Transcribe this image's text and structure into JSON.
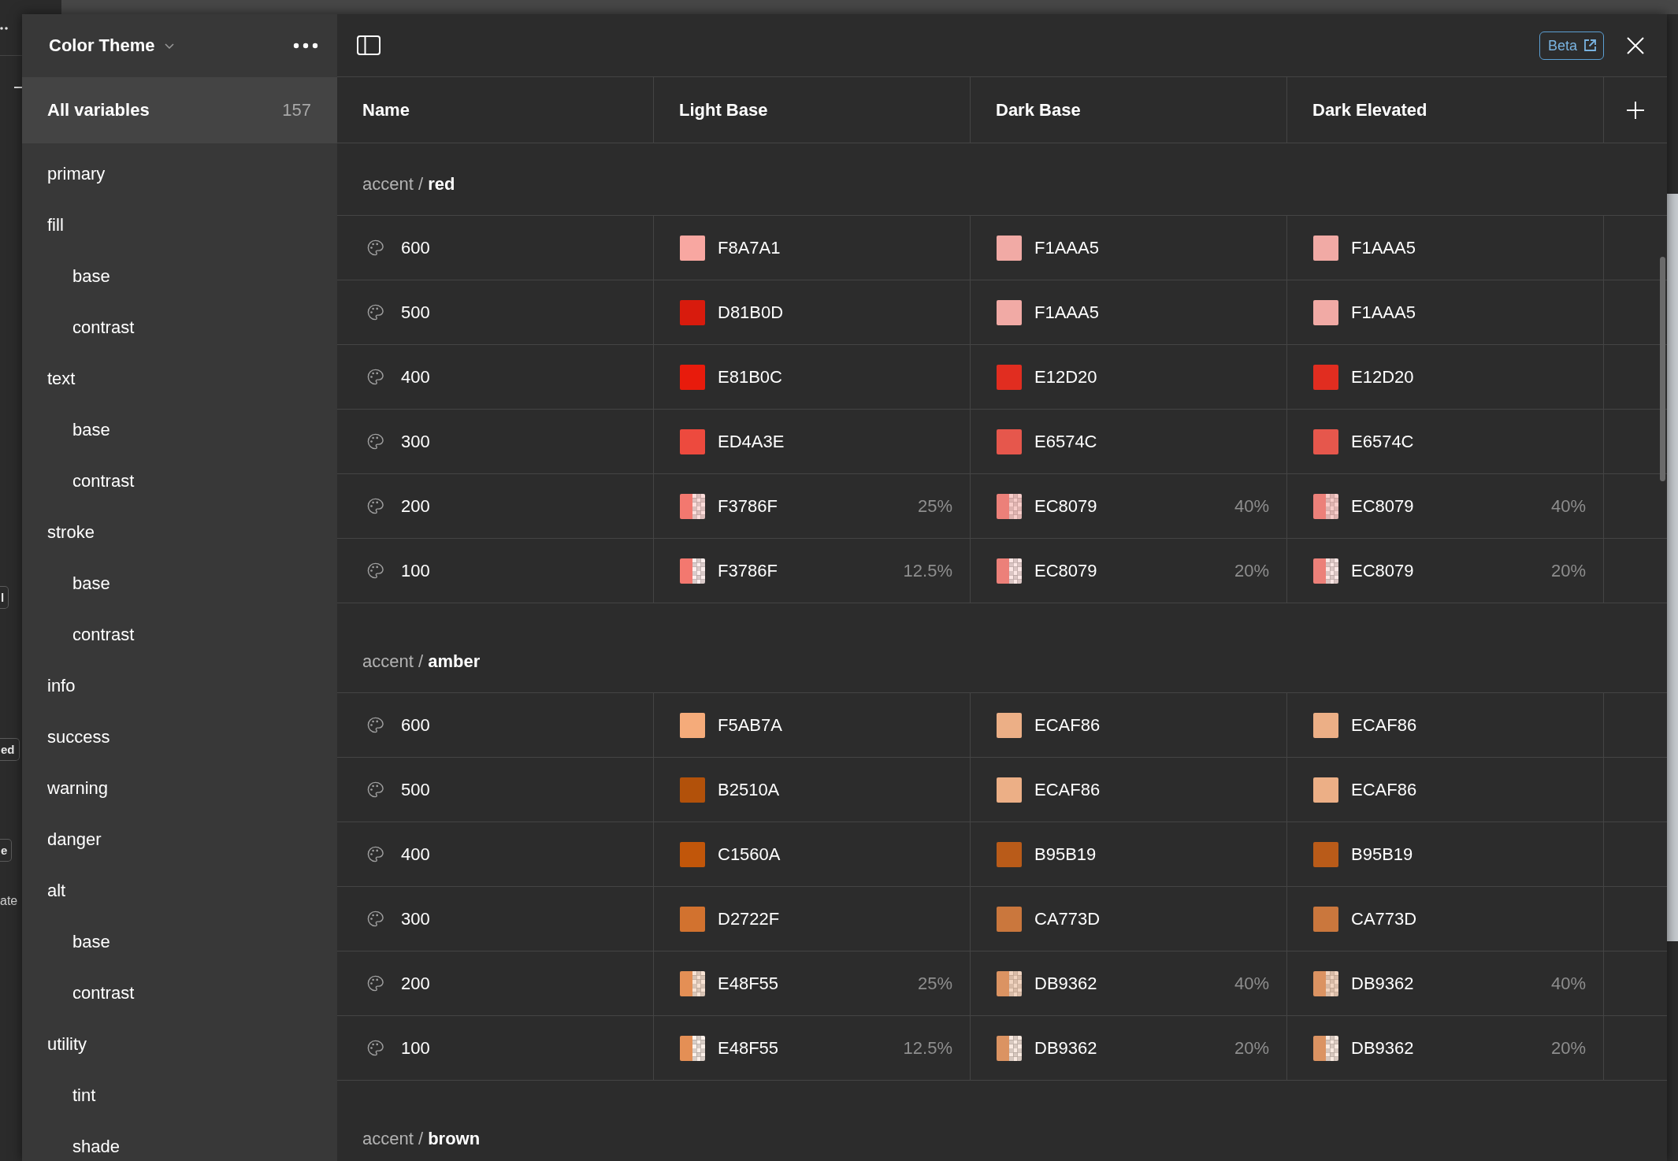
{
  "background": {
    "chips": [
      "l",
      "ed",
      "e"
    ],
    "caption": "ate"
  },
  "sidebar": {
    "title": "Color Theme",
    "items": [
      {
        "kind": "summary",
        "label": "All variables",
        "count": "157",
        "selected": true
      },
      {
        "kind": "group",
        "label": "primary",
        "selected": false
      },
      {
        "kind": "group",
        "label": "fill",
        "selected": false,
        "children": [
          {
            "kind": "group",
            "label": "base",
            "selected": false
          },
          {
            "kind": "group",
            "label": "contrast",
            "selected": false
          }
        ]
      },
      {
        "kind": "group",
        "label": "text",
        "selected": false,
        "children": [
          {
            "kind": "group",
            "label": "base",
            "selected": false
          },
          {
            "kind": "group",
            "label": "contrast",
            "selected": false
          }
        ]
      },
      {
        "kind": "group",
        "label": "stroke",
        "selected": false,
        "children": [
          {
            "kind": "group",
            "label": "base",
            "selected": false
          },
          {
            "kind": "group",
            "label": "contrast",
            "selected": false
          }
        ]
      },
      {
        "kind": "group",
        "label": "info",
        "selected": false
      },
      {
        "kind": "group",
        "label": "success",
        "selected": false
      },
      {
        "kind": "group",
        "label": "warning",
        "selected": false
      },
      {
        "kind": "group",
        "label": "danger",
        "selected": false
      },
      {
        "kind": "group",
        "label": "alt",
        "selected": false,
        "children": [
          {
            "kind": "group",
            "label": "base",
            "selected": false
          },
          {
            "kind": "group",
            "label": "contrast",
            "selected": false
          }
        ]
      },
      {
        "kind": "group",
        "label": "utility",
        "selected": false,
        "children": [
          {
            "kind": "group",
            "label": "tint",
            "selected": false
          },
          {
            "kind": "group",
            "label": "shade",
            "selected": false
          }
        ]
      }
    ]
  },
  "toolbar": {
    "badge": "Beta"
  },
  "table": {
    "columns": [
      "Name",
      "Light Base",
      "Dark Base",
      "Dark Elevated"
    ],
    "groups": [
      {
        "title": "accent / **red**",
        "rows": [
          {
            "name": "600",
            "cells": [
              {
                "hex": "F8A7A1",
                "color": "#f8a7a1"
              },
              {
                "hex": "F1AAA5",
                "color": "#f1aaa5"
              },
              {
                "hex": "F1AAA5",
                "color": "#f1aaa5"
              }
            ]
          },
          {
            "name": "500",
            "cells": [
              {
                "hex": "D81B0D",
                "color": "#d81b0d"
              },
              {
                "hex": "F1AAA5",
                "color": "#f1aaa5"
              },
              {
                "hex": "F1AAA5",
                "color": "#f1aaa5"
              }
            ]
          },
          {
            "name": "400",
            "cells": [
              {
                "hex": "E81B0C",
                "color": "#e81b0c"
              },
              {
                "hex": "E12D20",
                "color": "#e12d20"
              },
              {
                "hex": "E12D20",
                "color": "#e12d20"
              }
            ]
          },
          {
            "name": "300",
            "cells": [
              {
                "hex": "ED4A3E",
                "color": "#ed4a3e"
              },
              {
                "hex": "E6574C",
                "color": "#e6574c"
              },
              {
                "hex": "E6574C",
                "color": "#e6574c"
              }
            ]
          },
          {
            "name": "200",
            "cells": [
              {
                "hex": "F3786F",
                "color": "#f3786f",
                "alpha": "25%"
              },
              {
                "hex": "EC8079",
                "color": "#ec8079",
                "alpha": "40%"
              },
              {
                "hex": "EC8079",
                "color": "#ec8079",
                "alpha": "40%"
              }
            ]
          },
          {
            "name": "100",
            "cells": [
              {
                "hex": "F3786F",
                "color": "#f3786f",
                "alpha": "12.5%"
              },
              {
                "hex": "EC8079",
                "color": "#ec8079",
                "alpha": "20%"
              },
              {
                "hex": "EC8079",
                "color": "#ec8079",
                "alpha": "20%"
              }
            ]
          }
        ]
      },
      {
        "title": "accent / **amber**",
        "rows": [
          {
            "name": "600",
            "cells": [
              {
                "hex": "F5AB7A",
                "color": "#f5ab7a"
              },
              {
                "hex": "ECAF86",
                "color": "#ecaf86"
              },
              {
                "hex": "ECAF86",
                "color": "#ecaf86"
              }
            ]
          },
          {
            "name": "500",
            "cells": [
              {
                "hex": "B2510A",
                "color": "#b2510a"
              },
              {
                "hex": "ECAF86",
                "color": "#ecaf86"
              },
              {
                "hex": "ECAF86",
                "color": "#ecaf86"
              }
            ]
          },
          {
            "name": "400",
            "cells": [
              {
                "hex": "C1560A",
                "color": "#c1560a"
              },
              {
                "hex": "B95B19",
                "color": "#b95b19"
              },
              {
                "hex": "B95B19",
                "color": "#b95b19"
              }
            ]
          },
          {
            "name": "300",
            "cells": [
              {
                "hex": "D2722F",
                "color": "#d2722f"
              },
              {
                "hex": "CA773D",
                "color": "#ca773d"
              },
              {
                "hex": "CA773D",
                "color": "#ca773d"
              }
            ]
          },
          {
            "name": "200",
            "cells": [
              {
                "hex": "E48F55",
                "color": "#e48f55",
                "alpha": "25%"
              },
              {
                "hex": "DB9362",
                "color": "#db9362",
                "alpha": "40%"
              },
              {
                "hex": "DB9362",
                "color": "#db9362",
                "alpha": "40%"
              }
            ]
          },
          {
            "name": "100",
            "cells": [
              {
                "hex": "E48F55",
                "color": "#e48f55",
                "alpha": "12.5%"
              },
              {
                "hex": "DB9362",
                "color": "#db9362",
                "alpha": "20%"
              },
              {
                "hex": "DB9362",
                "color": "#db9362",
                "alpha": "20%"
              }
            ]
          }
        ]
      },
      {
        "title": "accent / **brown**"
      }
    ]
  }
}
